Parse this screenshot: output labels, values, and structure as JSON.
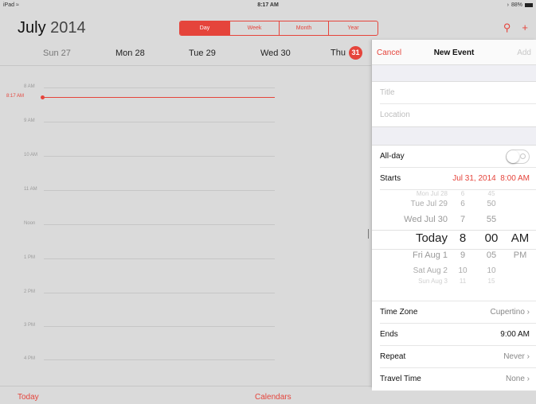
{
  "status_bar": {
    "device": "iPad",
    "wifi_icon": "wifi-icon",
    "time": "8:17 AM",
    "battery": "88%"
  },
  "header": {
    "month": "July",
    "year": "2014"
  },
  "view_segments": [
    "Day",
    "Week",
    "Month",
    "Year"
  ],
  "active_segment": "Day",
  "days": [
    {
      "label": "Sun 27",
      "muted": true
    },
    {
      "label": "Mon 28"
    },
    {
      "label": "Tue 29"
    },
    {
      "label": "Wed 30"
    },
    {
      "label": "Thu",
      "badge": "31"
    }
  ],
  "timeline": {
    "now_label": "8:17 AM",
    "hours": [
      "8 AM",
      "9 AM",
      "10 AM",
      "11 AM",
      "Noon",
      "1 PM",
      "2 PM",
      "3 PM",
      "4 PM"
    ]
  },
  "bottom_bar": {
    "today": "Today",
    "calendars": "Calendars"
  },
  "new_event": {
    "cancel": "Cancel",
    "title": "New Event",
    "add": "Add",
    "title_placeholder": "Title",
    "location_placeholder": "Location",
    "all_day_label": "All-day",
    "all_day_on": false,
    "starts_label": "Starts",
    "starts_date": "Jul 31, 2014",
    "starts_time": "8:00 AM",
    "picker": {
      "rows": [
        {
          "d": "Mon Jul 28",
          "h": "6",
          "m": "45",
          "p": ""
        },
        {
          "d": "Tue Jul 29",
          "h": "6",
          "m": "50",
          "p": ""
        },
        {
          "d": "Wed Jul 30",
          "h": "7",
          "m": "55",
          "p": ""
        },
        {
          "d": "Today",
          "h": "8",
          "m": "00",
          "p": "AM"
        },
        {
          "d": "Fri Aug 1",
          "h": "9",
          "m": "05",
          "p": "PM"
        },
        {
          "d": "Sat Aug 2",
          "h": "10",
          "m": "10",
          "p": ""
        },
        {
          "d": "Sun Aug 3",
          "h": "11",
          "m": "15",
          "p": ""
        }
      ]
    },
    "time_zone_label": "Time Zone",
    "time_zone_value": "Cupertino",
    "ends_label": "Ends",
    "ends_value": "9:00 AM",
    "repeat_label": "Repeat",
    "repeat_value": "Never",
    "travel_label": "Travel Time",
    "travel_value": "None"
  },
  "colors": {
    "accent": "#e5443b",
    "background": "#dadada",
    "panel": "#efeff4"
  }
}
